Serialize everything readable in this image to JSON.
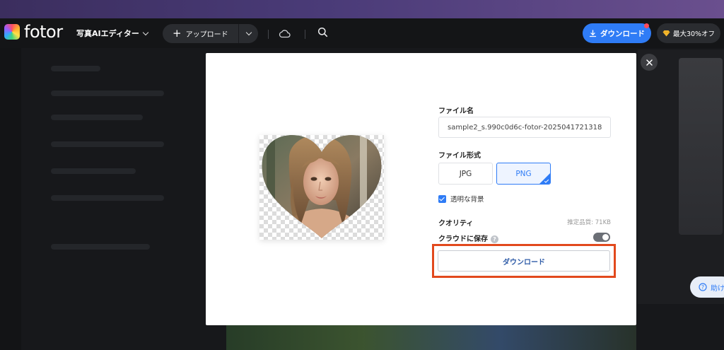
{
  "app": {
    "logo_text": "fotor",
    "editor_menu_label": "写真AIエディター",
    "upload_label": "アップロード",
    "download_label": "ダウンロード",
    "promo_label": "最大30%オフ"
  },
  "help": {
    "label": "助け"
  },
  "modal": {
    "filename_label": "ファイル名",
    "filename_value": "sample2_s.990c0d6c-fotor-2025041721318",
    "format_label": "ファイル形式",
    "formats": [
      "JPG",
      "PNG"
    ],
    "selected_format": "PNG",
    "transparent_bg_label": "透明な背景",
    "transparent_bg_checked": true,
    "quality_label": "クオリティ",
    "quality_estimate": "推定品質: 71KB",
    "cloud_save_label": "クラウドに保存",
    "cloud_save_enabled": false,
    "download_button": "ダウンロード"
  },
  "colors": {
    "accent": "#2f7cf6",
    "highlight": "#e2491d",
    "header_bg": "#141517"
  }
}
